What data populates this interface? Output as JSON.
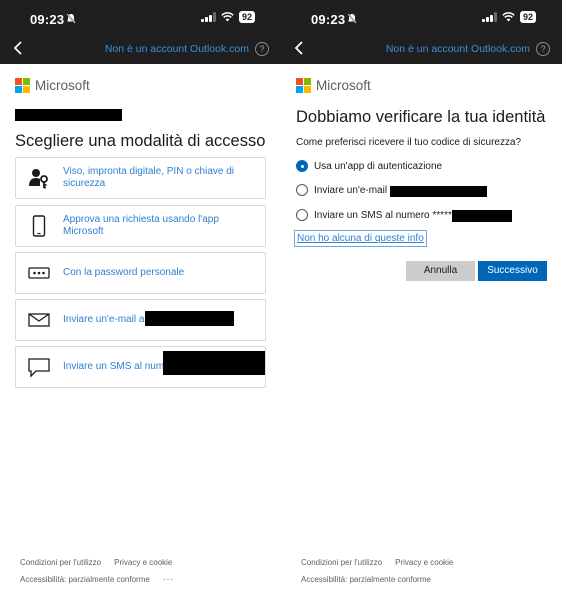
{
  "status_bar": {
    "time": "09:23",
    "battery": "92"
  },
  "header": {
    "account_link": "Non è un account Outlook.com",
    "help": "?"
  },
  "brand": {
    "name": "Microsoft",
    "colors": [
      "#f25022",
      "#7fba00",
      "#00a4ef",
      "#ffb900"
    ]
  },
  "left": {
    "title": "Scegliere una modalità di accesso",
    "options": [
      {
        "icon": "fingerprint-key-icon",
        "label": "Viso, impronta digitale, PIN o chiave di sicurezza"
      },
      {
        "icon": "phone-icon",
        "label": "Approva una richiesta usando l'app Microsoft"
      },
      {
        "icon": "password-icon",
        "label": "Con la password personale"
      },
      {
        "icon": "mail-icon",
        "label": "Inviare un'e-mail a"
      },
      {
        "icon": "sms-icon",
        "label": "Inviare un SMS al nume"
      }
    ]
  },
  "right": {
    "title": "Dobbiamo verificare la tua identità",
    "question": "Come preferisci ricevere il tuo codice di sicurezza?",
    "choices": [
      {
        "label": "Usa un'app di autenticazione",
        "selected": true
      },
      {
        "label": "Inviare un'e-mail a",
        "selected": false
      },
      {
        "label": "Inviare un SMS al numero ******",
        "selected": false
      }
    ],
    "none_link": "Non ho alcuna di queste info",
    "cancel": "Annulla",
    "next": "Successivo"
  },
  "footer": {
    "terms": "Condizioni per l'utilizzo",
    "privacy": "Privacy e cookie",
    "accessibility": "Accessibilità: parzialmente conforme",
    "more": "..."
  },
  "colors": {
    "accent": "#0067b8",
    "link": "#2f7fd2",
    "topbar": "#1f1f1f"
  }
}
